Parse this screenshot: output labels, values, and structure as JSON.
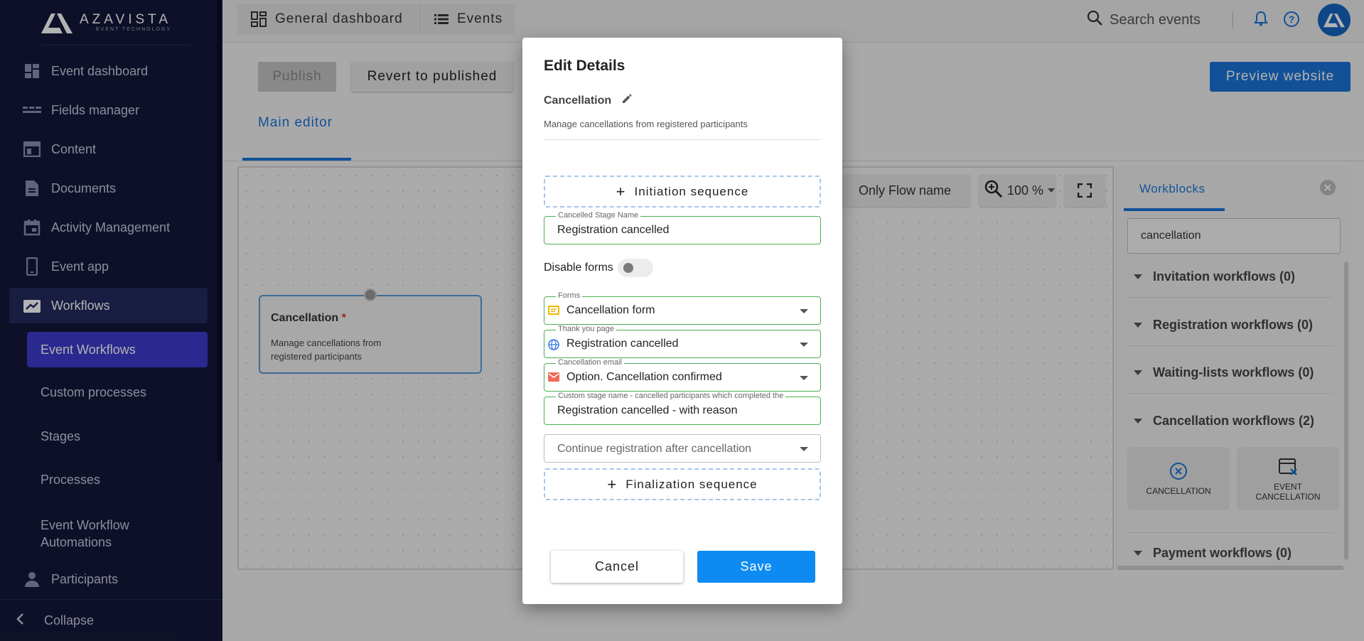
{
  "app": {
    "logo_text": "AZAVISTA",
    "logo_subtext": "EVENT TECHNOLOGY"
  },
  "sidebar": {
    "items": [
      {
        "label": "Event dashboard",
        "icon": "dashboard-icon"
      },
      {
        "label": "Fields manager",
        "icon": "fields-icon"
      },
      {
        "label": "Content",
        "icon": "content-icon"
      },
      {
        "label": "Documents",
        "icon": "document-icon"
      },
      {
        "label": "Activity Management",
        "icon": "calendar-icon"
      },
      {
        "label": "Event app",
        "icon": "phone-icon"
      },
      {
        "label": "Workflows",
        "icon": "workflow-icon"
      },
      {
        "label": "Participants",
        "icon": "person-icon"
      }
    ],
    "subitems": [
      {
        "label": "Event Workflows"
      },
      {
        "label": "Custom processes"
      },
      {
        "label": "Stages"
      },
      {
        "label": "Processes"
      },
      {
        "label": "Event Workflow Automations"
      }
    ],
    "collapse_label": "Collapse"
  },
  "topbar": {
    "general_dashboard": "General dashboard",
    "events": "Events",
    "search_placeholder": "Search events"
  },
  "toolbar": {
    "publish": "Publish",
    "revert": "Revert to published",
    "preview": "Preview website"
  },
  "editor": {
    "tab": "Main editor",
    "flow_name_toggle": "Only Flow name",
    "zoom": "100 %",
    "node": {
      "title": "Cancellation",
      "required_mark": "*",
      "description": "Manage cancellations from registered participants"
    }
  },
  "workblocks": {
    "tab": "Workblocks",
    "search_value": "cancellation",
    "groups": [
      "Invitation workflows (0)",
      "Registration workflows (0)",
      "Waiting-lists workflows (0)",
      "Cancellation workflows (2)",
      "Payment workflows (0)"
    ],
    "cards": [
      {
        "label": "CANCELLATION",
        "icon": "cancel-circle-icon"
      },
      {
        "label": "EVENT CANCELLATION",
        "icon": "calendar-cancel-icon"
      }
    ]
  },
  "modal": {
    "title": "Edit Details",
    "name": "Cancellation",
    "description": "Manage cancellations from registered participants",
    "initiation": "Initiation sequence",
    "cancelled_stage_label": "Cancelled Stage Name",
    "cancelled_stage_value": "Registration cancelled",
    "disable_forms": "Disable forms",
    "disable_forms_on": false,
    "forms_label": "Forms",
    "forms_value": "Cancellation form",
    "thankyou_label": "Thank you page",
    "thankyou_value": "Registration cancelled",
    "email_label": "Cancellation email",
    "email_value": "Option. Cancellation confirmed",
    "custom_stage_label": "Custom stage name - cancelled participants which completed the",
    "custom_stage_value": "Registration cancelled - with reason",
    "continue_placeholder": "Continue registration after cancellation",
    "finalization": "Finalization sequence",
    "cancel": "Cancel",
    "save": "Save"
  },
  "colors": {
    "sidebar_bg": "#14183a",
    "accent": "#1b74d8",
    "save": "#0d8bf2",
    "active_sub": "#3d3ccf",
    "field_border": "#4caf50"
  }
}
